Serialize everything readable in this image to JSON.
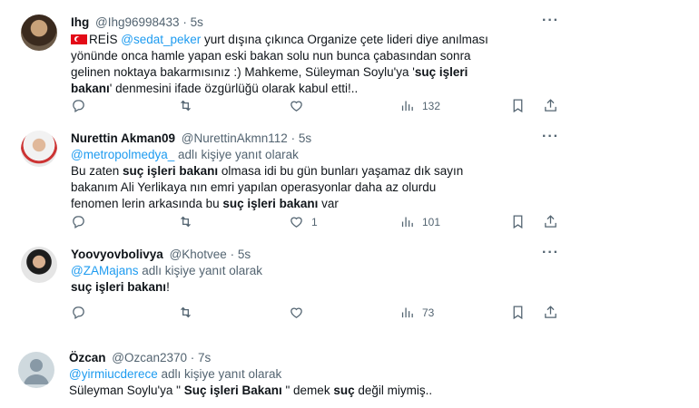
{
  "tweets": [
    {
      "name": "Ihg",
      "handle": "@Ihg96998433",
      "time": "5s",
      "lines": [
        "REİS @sedat_peker yurt dışına çıkınca Organize çete lideri diye anılması",
        "yönünde onca hamle yapan eski bakan solu nun bunca çabasından sonra",
        "gelinen noktaya bakarmısınız :) Mahkeme, Süleyman Soylu'ya 'suç işleri",
        "bakanı' denmesini ifade özgürlüğü olarak kabul etti!.."
      ],
      "frag": {
        "a": "REİS ",
        "mention": "@sedat_peker",
        "b": " yurt dışına çıkınca Organize çete lideri diye anılması",
        "c": "gelinen noktaya bakarmısınız :) Mahkeme, Süleyman Soylu'ya '",
        "bold1": "suç işleri",
        "bold2": "bakanı",
        "d": "' denmesini ifade özgürlüğü olarak kabul etti!.."
      },
      "views": "132"
    },
    {
      "name": "Nurettin Akman09",
      "handle": "@NurettinAkmn112",
      "time": "5s",
      "reply_mention": "@metropolmedya_",
      "reply_suffix": " adlı kişiye yanıt olarak",
      "l1a": "Bu zaten ",
      "l1b": "suç işleri bakanı",
      "l1c": " olmasa idi bu gün bunları yaşamaz dık  sayın",
      "l2": "bakanım Ali Yerlikaya nın emri yapılan operasyonlar daha az olurdu",
      "l3a": "fenomen lerin arkasında bu ",
      "l3b": "suç işleri bakanı",
      "l3c": " var",
      "likes": "1",
      "views": "101"
    },
    {
      "name": "Yoovyovbolivya",
      "handle": "@Khotvee",
      "time": "5s",
      "reply_mention": "@ZAMajans",
      "reply_suffix": " adlı kişiye yanıt olarak",
      "text": "suç işleri bakanı",
      "text_end": "!",
      "views": "73"
    },
    {
      "name": "Özcan",
      "handle": "@Ozcan2370",
      "time": "7s",
      "reply_mention": "@yirmiucderece",
      "reply_suffix": " adlı kişiye yanıt olarak",
      "t1": "Süleyman Soylu'ya \" ",
      "t2": "Suç  işleri Bakanı",
      "t3": " \" demek ",
      "t4": "suç",
      "t5": " değil miymiş.."
    }
  ],
  "sep": " · ",
  "more": "···",
  "colors": {
    "link": "#1d9bf0",
    "muted": "#536471",
    "text": "#0f1419"
  },
  "icons": [
    "reply-icon",
    "retweet-icon",
    "like-icon",
    "views-icon",
    "bookmark-icon",
    "share-icon",
    "flag-icon"
  ]
}
